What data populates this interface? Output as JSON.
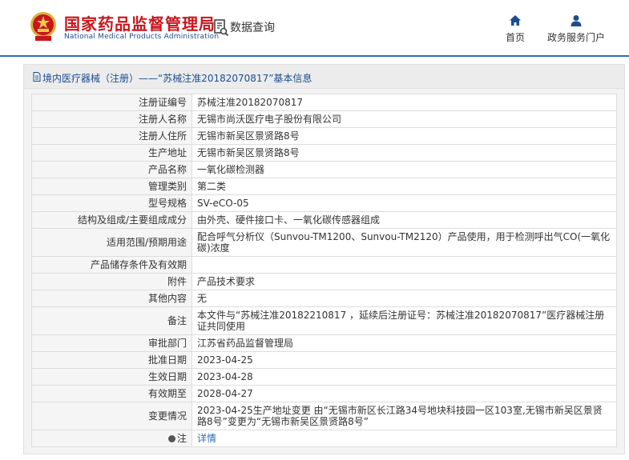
{
  "header": {
    "site_title_cn": "国家药品监督管理局",
    "site_title_en": "National Medical Products Administration",
    "section_title": "数据查询",
    "nav": [
      {
        "label": "首页",
        "icon": "home-icon"
      },
      {
        "label": "政务服务门户",
        "icon": "user-icon"
      }
    ]
  },
  "colors": {
    "brand_red": "#c8161d",
    "brand_blue": "#1b4d8f",
    "link_blue": "#2b6eb5"
  },
  "panel": {
    "title": "境内医疗器械（注册）——“苏械注准20182070817”基本信息"
  },
  "record": {
    "rows": [
      {
        "label": "注册证编号",
        "value": "苏械注准20182070817"
      },
      {
        "label": "注册人名称",
        "value": "无锡市尚沃医疗电子股份有限公司"
      },
      {
        "label": "注册人住所",
        "value": "无锡市新吴区景贤路8号"
      },
      {
        "label": "生产地址",
        "value": "无锡市新吴区景贤路8号"
      },
      {
        "label": "产品名称",
        "value": "一氧化碳检测器"
      },
      {
        "label": "管理类别",
        "value": "第二类"
      },
      {
        "label": "型号规格",
        "value": "SV-eCO-05"
      },
      {
        "label": "结构及组成/主要组成成分",
        "value": "由外壳、硬件接口卡、一氧化碳传感器组成"
      },
      {
        "label": "适用范围/预期用途",
        "value": "配合呼气分析仪（Sunvou-TM1200、Sunvou-TM2120）产品使用，用于检测呼出气CO(一氧化碳)浓度"
      },
      {
        "label": "产品储存条件及有效期",
        "value": ""
      },
      {
        "label": "附件",
        "value": "产品技术要求"
      },
      {
        "label": "其他内容",
        "value": "无"
      },
      {
        "label": "备注",
        "value": "本文件与“苏械注准20182210817 ，延续后注册证号：苏械注准20182070817”医疗器械注册证共同使用"
      },
      {
        "label": "审批部门",
        "value": "江苏省药品监督管理局"
      },
      {
        "label": "批准日期",
        "value": "2023-04-25"
      },
      {
        "label": "生效日期",
        "value": "2023-04-28"
      },
      {
        "label": "有效期至",
        "value": "2028-04-27"
      },
      {
        "label": "变更情况",
        "value": "2023-04-25生产地址变更 由“无锡市新区长江路34号地块科技园一区103室,无锡市新吴区景贤路8号”变更为“无锡市新吴区景贤路8号”"
      }
    ],
    "note_label": "注",
    "note_link": "详情"
  }
}
